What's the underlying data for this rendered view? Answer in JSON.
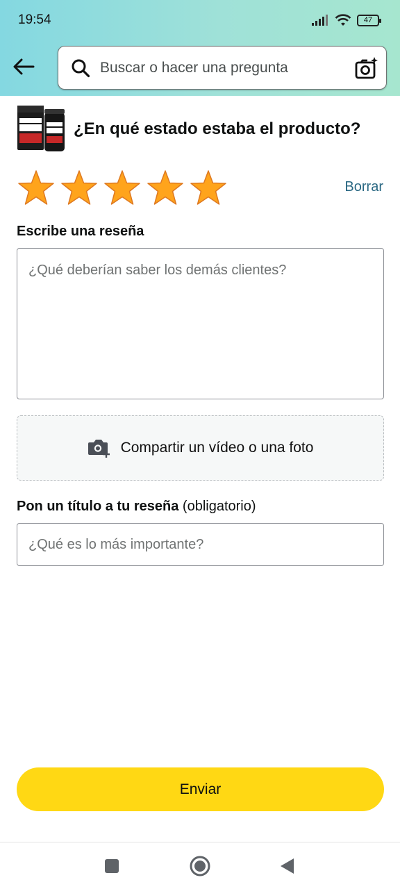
{
  "status_bar": {
    "time": "19:54",
    "battery": "47"
  },
  "search": {
    "placeholder": "Buscar o hacer una pregunta"
  },
  "product": {
    "question": "¿En qué estado estaba el producto?"
  },
  "rating": {
    "value": 5,
    "max": 5,
    "clear_label": "Borrar",
    "star_color": "#ffa41c"
  },
  "review": {
    "label": "Escribe una reseña",
    "placeholder": "¿Qué deberían saber los demás clientes?"
  },
  "media": {
    "label": "Compartir un vídeo o una foto"
  },
  "title_field": {
    "label": "Pon un título a tu reseña",
    "hint": "(obligatorio)",
    "placeholder": "¿Qué es lo más importante?"
  },
  "submit": {
    "label": "Enviar",
    "color": "#ffd814"
  },
  "nav": {
    "icons": [
      "recents-square-icon",
      "home-circle-icon",
      "back-triangle-icon"
    ]
  }
}
